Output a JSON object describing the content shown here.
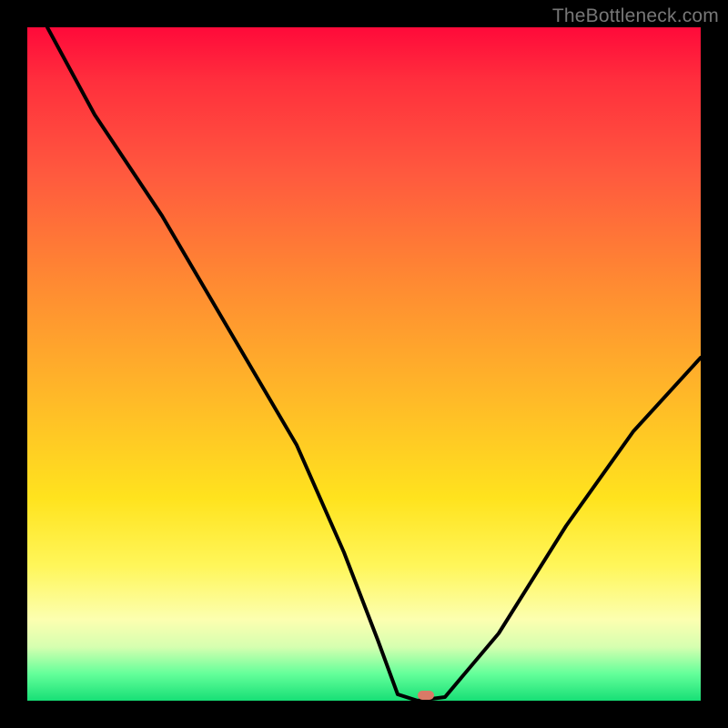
{
  "watermark": "TheBottleneck.com",
  "chart_data": {
    "type": "line",
    "title": "",
    "xlabel": "",
    "ylabel": "",
    "xlim": [
      0,
      100
    ],
    "ylim": [
      0,
      100
    ],
    "grid": false,
    "x": [
      3,
      10,
      20,
      30,
      40,
      47,
      52,
      55,
      58,
      62,
      70,
      80,
      90,
      100
    ],
    "values": [
      100,
      87,
      72,
      55,
      38,
      22,
      9,
      1,
      0,
      0.5,
      10,
      26,
      40,
      51
    ],
    "minimum_marker": {
      "x": 59,
      "y": 0
    },
    "background_gradient": {
      "top": "#ff0a3a",
      "mid_upper": "#ff8a32",
      "mid": "#ffe31e",
      "mid_lower": "#fcffb0",
      "bottom": "#17df76"
    }
  }
}
